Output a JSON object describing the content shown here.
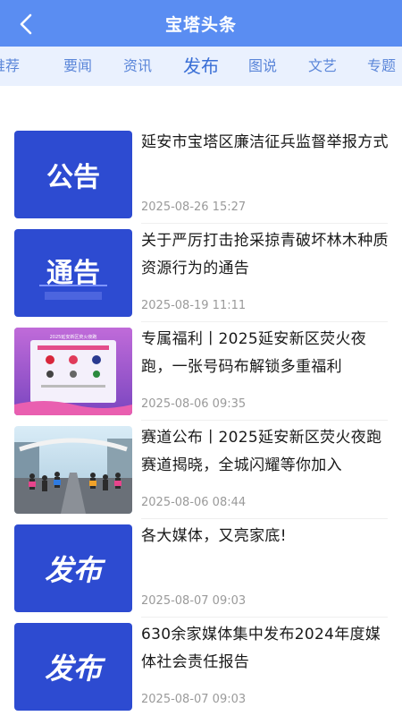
{
  "header": {
    "title": "宝塔头条"
  },
  "tabs": [
    {
      "label": "推荐"
    },
    {
      "label": "要闻"
    },
    {
      "label": "资讯"
    },
    {
      "label": "发布"
    },
    {
      "label": "图说"
    },
    {
      "label": "文艺"
    },
    {
      "label": "专题"
    }
  ],
  "articles": [
    {
      "title": "延安市宝塔区廉洁征兵监督举报方式",
      "date": "2025-08-26 15:27",
      "thumb_text": "公告",
      "thumb_icon": "announcement-image"
    },
    {
      "title": "关于严厉打击抢采掠青破坏林木种质资源行为的通告",
      "date": "2025-08-19 11:11",
      "thumb_text": "通告",
      "thumb_icon": "notice-image"
    },
    {
      "title": "专属福利丨2025延安新区荧火夜跑，一张号码布解锁多重福利",
      "date": "2025-08-06 09:35",
      "thumb_text": "2025延安新区荧火夜跑",
      "thumb_icon": "night-run-poster-image"
    },
    {
      "title": "赛道公布丨2025延安新区荧火夜跑赛道揭晓，全城闪耀等你加入",
      "date": "2025-08-06 08:44",
      "thumb_text": "",
      "thumb_icon": "runners-photo-image"
    },
    {
      "title": "各大媒体，又亮家底!",
      "date": "2025-08-07 09:03",
      "thumb_text": "发布",
      "thumb_icon": "release-image"
    },
    {
      "title": "630余家媒体集中发布2024年度媒体社会责任报告",
      "date": "2025-08-07 09:03",
      "thumb_text": "发布",
      "thumb_icon": "release-image"
    }
  ],
  "colors": {
    "header_bg": "#5a8df2",
    "tab_bg": "#eaf1fe",
    "tab_text": "#5b86d9",
    "thumb_blue": "#2d4bd1"
  }
}
